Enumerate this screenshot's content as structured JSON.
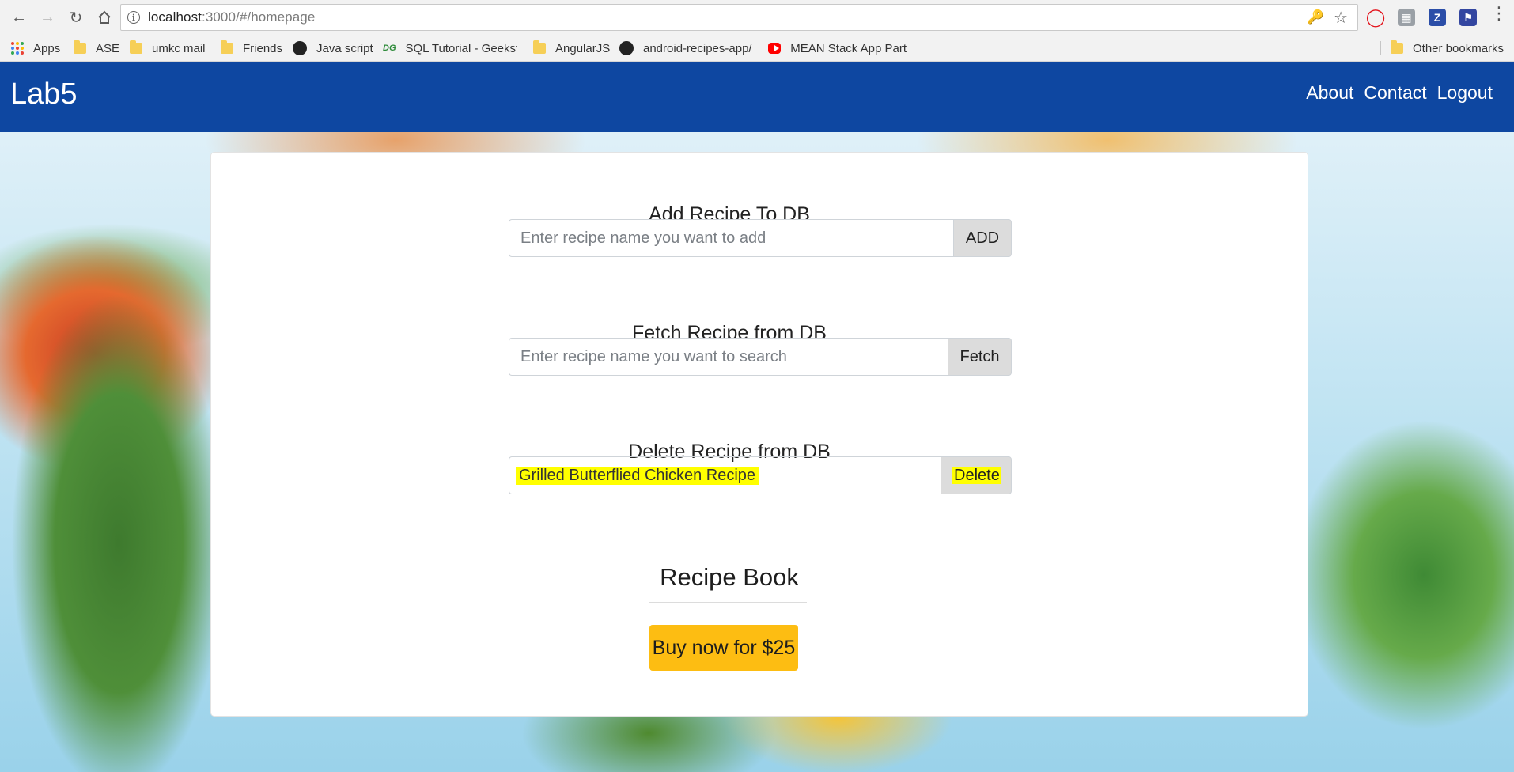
{
  "browser": {
    "url_host": "localhost",
    "url_rest": ":3000/#/homepage",
    "bookmarks": [
      {
        "label": "Apps",
        "icon": "apps-grid-icon"
      },
      {
        "label": "ASE",
        "icon": "folder-icon"
      },
      {
        "label": "umkc mail",
        "icon": "folder-icon"
      },
      {
        "label": "Friends",
        "icon": "folder-icon"
      },
      {
        "label": "Java script",
        "icon": "github-icon"
      },
      {
        "label": "SQL Tutorial - Geeksf",
        "icon": "geeksforgeeks-icon"
      },
      {
        "label": "AngularJS",
        "icon": "folder-icon"
      },
      {
        "label": "android-recipes-app/",
        "icon": "github-icon"
      },
      {
        "label": "MEAN Stack App Part",
        "icon": "youtube-icon"
      }
    ],
    "other_bookmarks": "Other bookmarks"
  },
  "navbar": {
    "brand": "Lab5",
    "links": [
      "About",
      "Contact",
      "Logout"
    ]
  },
  "add": {
    "title": "Add Recipe To DB",
    "placeholder": "Enter recipe name you want to add",
    "button": "ADD"
  },
  "fetch": {
    "title": "Fetch Recipe from DB",
    "placeholder": "Enter recipe name you want to search",
    "button": "Fetch"
  },
  "delete": {
    "title": "Delete Recipe from DB",
    "value": "Grilled Butterflied Chicken Recipe",
    "button": "Delete"
  },
  "recipe_book": {
    "title": "Recipe Book",
    "buy_button": "Buy now for $25"
  },
  "colors": {
    "navbar": "#0e47a1",
    "buy_button": "#fdbd12",
    "highlight": "#ffff00"
  }
}
